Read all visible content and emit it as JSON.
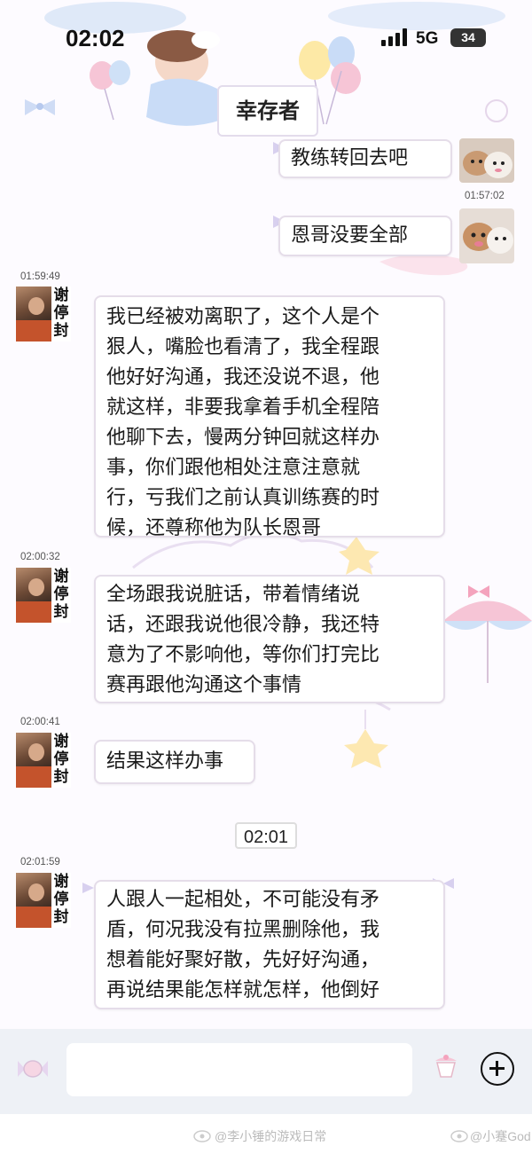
{
  "status_bar": {
    "time": "02:02",
    "network": "5G",
    "battery": "34"
  },
  "chat": {
    "title": "幸存者"
  },
  "messages": [
    {
      "side": "right",
      "text": "教练转回去吧"
    },
    {
      "side": "right",
      "timestamp": "01:57:02",
      "text": "恩哥没要全部"
    },
    {
      "side": "left",
      "timestamp": "01:59:49",
      "sender": "谢停封",
      "lines": [
        "我已经被劝离职了，这个人是个",
        "狠人，嘴脸也看清了，我全程跟",
        "他好好沟通，我还没说不退，他",
        "就这样，非要我拿着手机全程陪",
        "他聊下去，慢两分钟回就这样办",
        "事，你们跟他相处注意注意就",
        "行，亏我们之前认真训练赛的时",
        "候，还尊称他为队长恩哥"
      ]
    },
    {
      "side": "left",
      "timestamp": "02:00:32",
      "sender": "谢停封",
      "lines": [
        "全场跟我说脏话，带着情绪说",
        "话，还跟我说他很冷静，我还特",
        "意为了不影响他，等你们打完比",
        "赛再跟他沟通这个事情"
      ]
    },
    {
      "side": "left",
      "timestamp": "02:00:41",
      "sender": "谢停封",
      "lines": [
        "结果这样办事"
      ]
    },
    {
      "side": "left",
      "timestamp": "02:01:59",
      "sender": "谢停封",
      "lines": [
        "人跟人一起相处，不可能没有矛",
        "盾，何况我没有拉黑删除他，我",
        "想着能好聚好散，先好好沟通，",
        "再说结果能怎样就怎样，他倒好"
      ]
    }
  ],
  "divider_time": "02:01",
  "sender_name_chars": [
    "谢",
    "停",
    "封"
  ],
  "watermarks": {
    "left": "@李小锤的游戏日常",
    "right": "@小蹇God"
  },
  "icons": [
    "signal-icon",
    "battery-icon",
    "plus-icon",
    "candy-icon",
    "cup-icon",
    "bow-icon",
    "balloon-icon",
    "weibo-icon"
  ],
  "colors": {
    "bubble_border": "#e5dde9",
    "input_bar": "#eef1f6",
    "accent_pink": "#f4b6c8",
    "accent_blue": "#bcd3f2"
  }
}
